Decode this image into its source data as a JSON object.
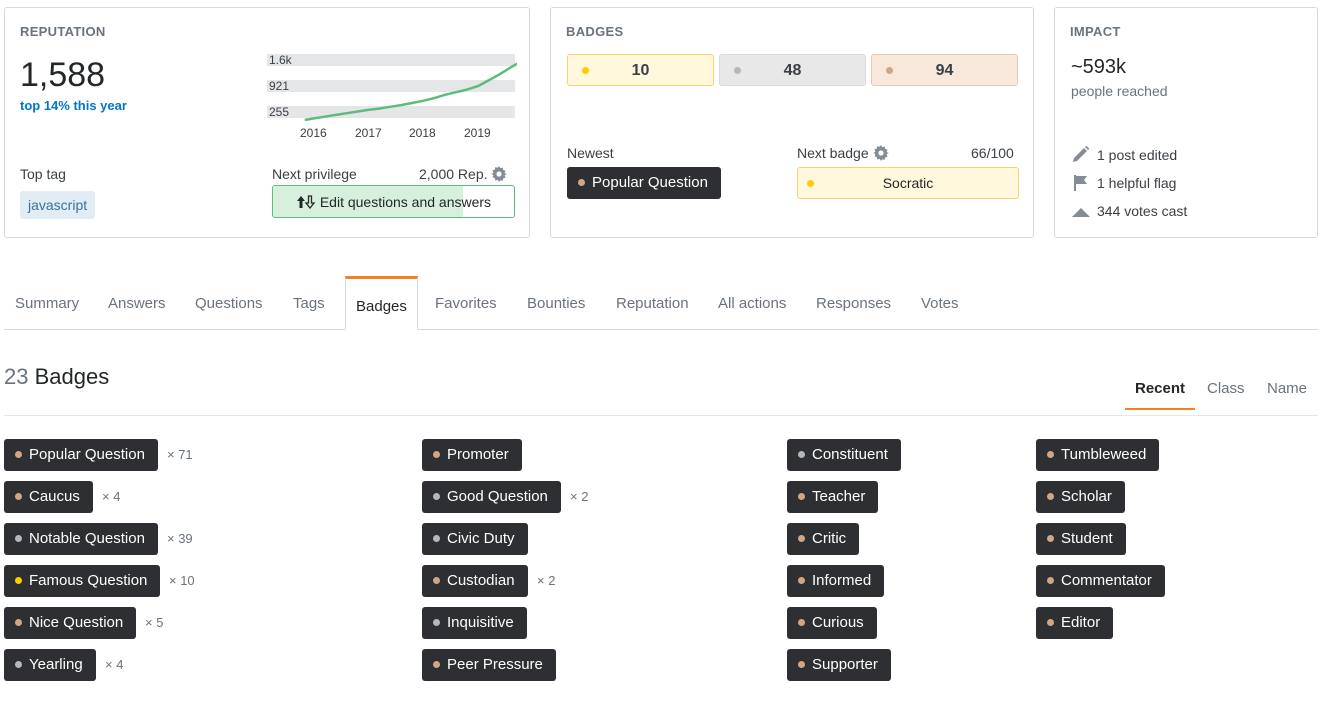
{
  "colors": {
    "gold": "#ffcc01",
    "silver": "#b4b8bc",
    "bronze": "#d1a684",
    "accent": "#f48024",
    "link": "#0077cc",
    "pill_bg": "#2d2f33"
  },
  "reputation": {
    "title": "REPUTATION",
    "value": "1,588",
    "rank": "top 14% this year",
    "chart_y_labels": [
      "1.6k",
      "921",
      "255"
    ],
    "chart_x_labels": [
      "2016",
      "2017",
      "2018",
      "2019"
    ],
    "top_tag_label": "Top tag",
    "top_tag": "javascript",
    "next_privilege_label": "Next privilege",
    "next_privilege_rep": "2,000 Rep.",
    "privilege_name": "Edit questions and answers",
    "privilege_progress": 0.79
  },
  "chart_data": {
    "type": "line",
    "x": [
      2015.85,
      2016.0,
      2016.2,
      2016.4,
      2016.6,
      2016.8,
      2017.0,
      2017.2,
      2017.4,
      2017.6,
      2017.8,
      2018.0,
      2018.2,
      2018.4,
      2018.6,
      2018.8,
      2019.0,
      2019.2,
      2019.4,
      2019.6,
      2019.75
    ],
    "values": [
      255,
      290,
      330,
      370,
      410,
      450,
      490,
      520,
      560,
      600,
      650,
      700,
      760,
      840,
      900,
      960,
      1040,
      1180,
      1320,
      1480,
      1588
    ],
    "ylim": [
      255,
      1600
    ],
    "y_ticks": [
      "1.6k",
      "921",
      "255"
    ],
    "x_ticks": [
      "2016",
      "2017",
      "2018",
      "2019"
    ],
    "title": "",
    "xlabel": "",
    "ylabel": ""
  },
  "badges_summary": {
    "title": "BADGES",
    "gold": "10",
    "silver": "48",
    "bronze": "94",
    "newest_label": "Newest",
    "newest_badge": "Popular Question",
    "next_badge_label": "Next badge",
    "next_badge_progress": "66/100",
    "next_badge_name": "Socratic"
  },
  "impact": {
    "title": "IMPACT",
    "value": "~593k",
    "subtitle": "people reached",
    "rows": [
      "1 post edited",
      "1 helpful flag",
      "344 votes cast"
    ]
  },
  "tabs": [
    "Summary",
    "Answers",
    "Questions",
    "Tags",
    "Badges",
    "Favorites",
    "Bounties",
    "Reputation",
    "All actions",
    "Responses",
    "Votes"
  ],
  "badges_section": {
    "count": "23",
    "label": "Badges",
    "sort_options": [
      "Recent",
      "Class",
      "Name"
    ]
  },
  "badge_columns": [
    [
      {
        "name": "Popular Question",
        "class": "bronze",
        "count": "× 71"
      },
      {
        "name": "Caucus",
        "class": "bronze",
        "count": "× 4"
      },
      {
        "name": "Notable Question",
        "class": "silver",
        "count": "× 39"
      },
      {
        "name": "Famous Question",
        "class": "gold",
        "count": "× 10"
      },
      {
        "name": "Nice Question",
        "class": "bronze",
        "count": "× 5"
      },
      {
        "name": "Yearling",
        "class": "silver",
        "count": "× 4"
      }
    ],
    [
      {
        "name": "Promoter",
        "class": "bronze",
        "count": ""
      },
      {
        "name": "Good Question",
        "class": "silver",
        "count": "× 2"
      },
      {
        "name": "Civic Duty",
        "class": "silver",
        "count": ""
      },
      {
        "name": "Custodian",
        "class": "bronze",
        "count": "× 2"
      },
      {
        "name": "Inquisitive",
        "class": "silver",
        "count": ""
      },
      {
        "name": "Peer Pressure",
        "class": "bronze",
        "count": ""
      }
    ],
    [
      {
        "name": "Constituent",
        "class": "silver",
        "count": ""
      },
      {
        "name": "Teacher",
        "class": "bronze",
        "count": ""
      },
      {
        "name": "Critic",
        "class": "bronze",
        "count": ""
      },
      {
        "name": "Informed",
        "class": "bronze",
        "count": ""
      },
      {
        "name": "Curious",
        "class": "bronze",
        "count": ""
      },
      {
        "name": "Supporter",
        "class": "bronze",
        "count": ""
      }
    ],
    [
      {
        "name": "Tumbleweed",
        "class": "bronze",
        "count": ""
      },
      {
        "name": "Scholar",
        "class": "bronze",
        "count": ""
      },
      {
        "name": "Student",
        "class": "bronze",
        "count": ""
      },
      {
        "name": "Commentator",
        "class": "bronze",
        "count": ""
      },
      {
        "name": "Editor",
        "class": "bronze",
        "count": ""
      }
    ]
  ]
}
